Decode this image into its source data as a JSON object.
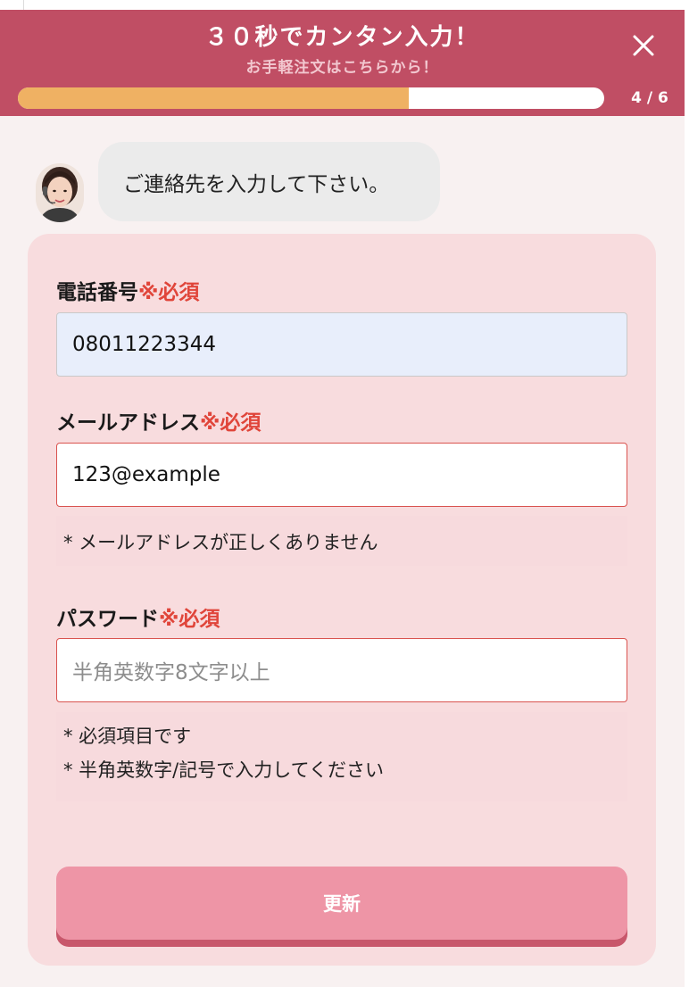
{
  "header": {
    "title": "３０秒でカンタン入力！",
    "subtitle": "お手軽注文はこちらから！",
    "close_icon": "close-icon",
    "progress": {
      "current": 4,
      "total": 6,
      "label": "4 / 6",
      "fraction": 0.667
    }
  },
  "chat": {
    "avatar": "operator-avatar",
    "message": "ご連絡先を入力して下さい。"
  },
  "form": {
    "phone": {
      "label": "電話番号",
      "required": "※必須",
      "value": "08011223344"
    },
    "email": {
      "label": "メールアドレス",
      "required": "※必須",
      "value": "123@example",
      "error": "* メールアドレスが正しくありません"
    },
    "password": {
      "label": "パスワード",
      "required": "※必須",
      "placeholder": "半角英数字8文字以上",
      "errors": [
        "* 必須項目です",
        "* 半角英数字/記号で入力してください"
      ]
    },
    "submit_label": "更新"
  },
  "colors": {
    "header_bg": "#c04e64",
    "progress_fill": "#efb163",
    "card_bg": "#f8dcde",
    "required_red": "#e0453a",
    "button_bg": "#ee95a6"
  }
}
